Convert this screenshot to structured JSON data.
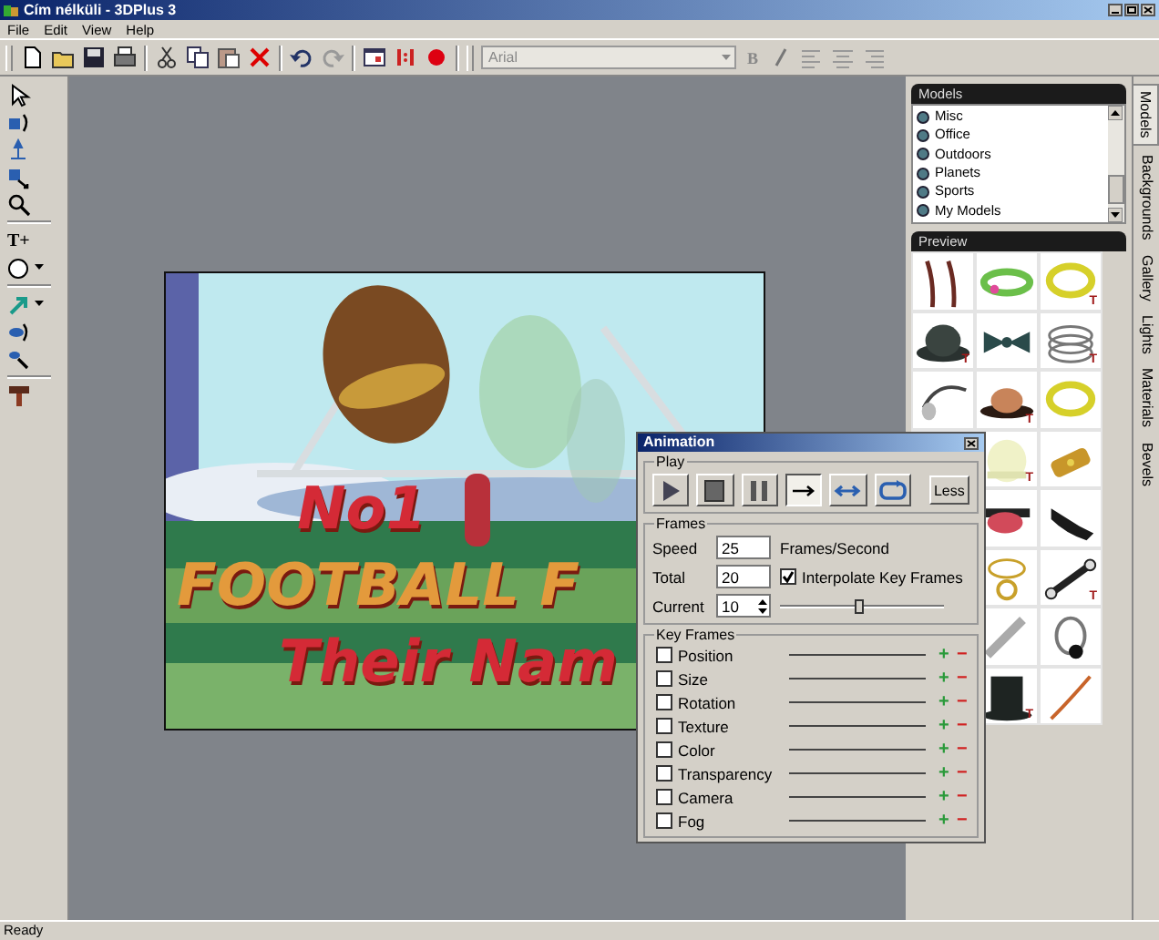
{
  "window": {
    "title": "Cím nélküli - 3DPlus 3"
  },
  "menu": [
    "File",
    "Edit",
    "View",
    "Help"
  ],
  "toolbar": {
    "buttons": [
      {
        "kind": "new"
      },
      {
        "kind": "open"
      },
      {
        "kind": "save"
      },
      {
        "kind": "print"
      },
      {
        "kind": "separator"
      },
      {
        "kind": "cut"
      },
      {
        "kind": "copy"
      },
      {
        "kind": "paste"
      },
      {
        "kind": "delete"
      },
      {
        "kind": "separator"
      },
      {
        "kind": "undo"
      },
      {
        "kind": "redo"
      },
      {
        "kind": "separator"
      },
      {
        "kind": "frame"
      },
      {
        "kind": "ratio"
      },
      {
        "kind": "record"
      }
    ],
    "font": {
      "value": "Arial"
    },
    "format_buttons": [
      {
        "kind": "bold",
        "label": "B"
      },
      {
        "kind": "italic"
      },
      {
        "kind": "align-left"
      },
      {
        "kind": "align-center"
      },
      {
        "kind": "align-right"
      }
    ]
  },
  "toolbox": [
    {
      "kind": "select",
      "dropdown": false
    },
    {
      "kind": "rotate",
      "dropdown": false
    },
    {
      "kind": "move",
      "dropdown": false
    },
    {
      "kind": "resize",
      "dropdown": false
    },
    {
      "kind": "zoom",
      "dropdown": false
    },
    {
      "kind": "separator"
    },
    {
      "kind": "text",
      "label": "T+",
      "dropdown": false
    },
    {
      "kind": "ellipse",
      "dropdown": true
    },
    {
      "kind": "separator"
    },
    {
      "kind": "arrow",
      "dropdown": true
    },
    {
      "kind": "orbit",
      "dropdown": false
    },
    {
      "kind": "paint",
      "dropdown": false
    },
    {
      "kind": "separator"
    },
    {
      "kind": "hammer",
      "dropdown": false
    }
  ],
  "scene": {
    "lines": [
      {
        "text": "No1",
        "color": "#d42a36"
      },
      {
        "text": "FOOTBALL F",
        "color": "#e39a3c"
      },
      {
        "text": "Their Nam",
        "color": "#d42a36"
      }
    ]
  },
  "models": {
    "title": "Models",
    "items": [
      "Misc",
      "Office",
      "Outdoors",
      "Planets",
      "Sports",
      "My Models"
    ]
  },
  "preview": {
    "title": "Preview",
    "rows": [
      [
        {
          "kind": "cane"
        },
        {
          "kind": "bracelet"
        },
        {
          "kind": "ring",
          "badge": "T"
        }
      ],
      [
        {
          "kind": "bowler",
          "badge": "T"
        },
        {
          "kind": "bowtie"
        },
        {
          "kind": "spring",
          "badge": "T"
        }
      ],
      [
        {
          "kind": "headband"
        },
        {
          "kind": "hat",
          "badge": "T"
        },
        {
          "kind": "ring"
        }
      ],
      [
        "",
        {
          "kind": "bonnet",
          "badge": "T"
        },
        {
          "kind": "scroll"
        }
      ],
      [
        "",
        {
          "kind": "redhat"
        },
        {
          "kind": "shoe"
        }
      ],
      [
        "",
        {
          "kind": "pendant"
        },
        {
          "kind": "wrench",
          "badge": "T"
        }
      ],
      [
        "",
        {
          "kind": "pipe"
        },
        {
          "kind": "headphones"
        }
      ],
      [
        "",
        {
          "kind": "tophat",
          "badge": "T"
        },
        {
          "kind": "stick"
        }
      ]
    ]
  },
  "side_tabs": [
    {
      "label": "Models",
      "selected": true
    },
    {
      "label": "Backgrounds",
      "selected": false
    },
    {
      "label": "Gallery",
      "selected": false
    },
    {
      "label": "Lights",
      "selected": false
    },
    {
      "label": "Materials",
      "selected": false
    },
    {
      "label": "Bevels",
      "selected": false
    }
  ],
  "animation": {
    "title": "Animation",
    "play": {
      "label": "Play",
      "buttons": [
        {
          "kind": "play",
          "selected": false
        },
        {
          "kind": "stop",
          "selected": false
        },
        {
          "kind": "pause",
          "selected": false
        },
        {
          "kind": "once",
          "selected": true
        },
        {
          "kind": "pingpong",
          "selected": false
        },
        {
          "kind": "loop",
          "selected": false
        }
      ],
      "less": "Less"
    },
    "frames": {
      "label": "Frames",
      "speed": {
        "label": "Speed",
        "value": "25",
        "unit": "Frames/Second"
      },
      "total": {
        "label": "Total",
        "value": "20"
      },
      "interpolate": {
        "label": "Interpolate Key Frames",
        "checked": true
      },
      "current": {
        "label": "Current",
        "value": "10"
      },
      "slider": {
        "level": 0.48
      }
    },
    "key_frames": {
      "label": "Key Frames",
      "rows": [
        {
          "label": "Position",
          "checked": false,
          "add": "+",
          "remove": "−"
        },
        {
          "label": "Size",
          "checked": false,
          "add": "+",
          "remove": "−"
        },
        {
          "label": "Rotation",
          "checked": false,
          "add": "+",
          "remove": "−"
        },
        {
          "label": "Texture",
          "checked": false,
          "add": "+",
          "remove": "−"
        },
        {
          "label": "Color",
          "checked": false,
          "add": "+",
          "remove": "−"
        },
        {
          "label": "Transparency",
          "checked": false,
          "add": "+",
          "remove": "−"
        },
        {
          "label": "Camera",
          "checked": false,
          "add": "+",
          "remove": "−"
        },
        {
          "label": "Fog",
          "checked": false,
          "add": "+",
          "remove": "−"
        }
      ]
    }
  },
  "status_bar": "Ready"
}
